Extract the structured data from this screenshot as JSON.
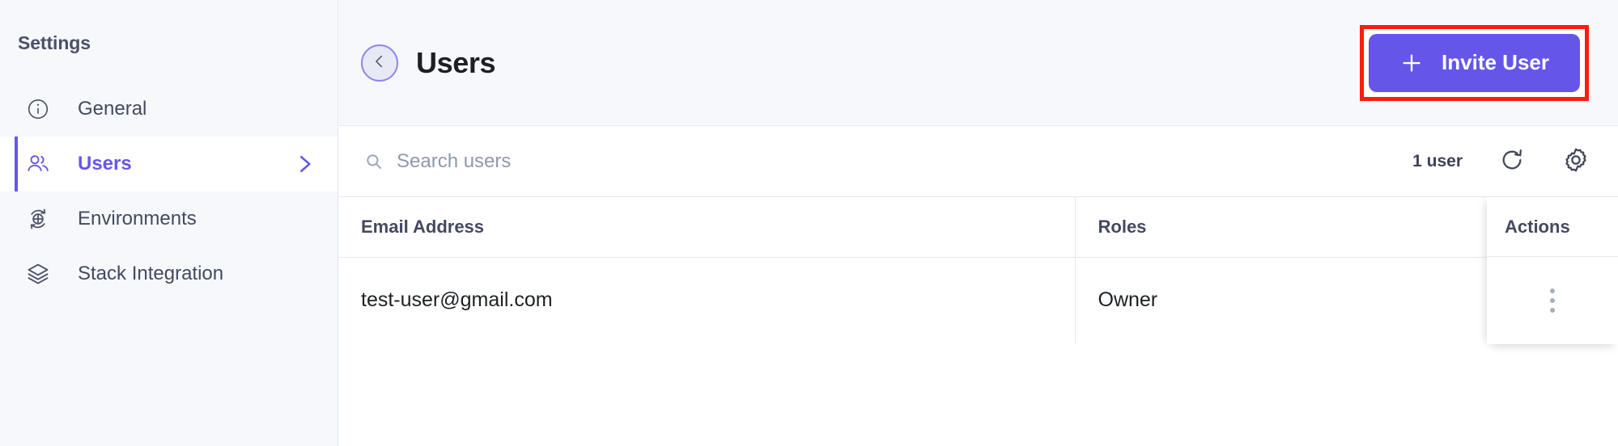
{
  "theme": {
    "accent": "#6556e9",
    "highlight": "#fa1e08",
    "sidebar_bg": "#f6f8fc",
    "header_bg": "#f7f8fc",
    "border": "#e3e8f0",
    "text": "#1c2025",
    "muted": "#8e98b0"
  },
  "sidebar": {
    "title": "Settings",
    "items": [
      {
        "label": "General",
        "icon": "info-circle-icon",
        "active": false
      },
      {
        "label": "Users",
        "icon": "users-icon",
        "active": true
      },
      {
        "label": "Environments",
        "icon": "environments-globe-icon",
        "active": false
      },
      {
        "label": "Stack Integration",
        "icon": "layers-icon",
        "active": false
      }
    ]
  },
  "header": {
    "back_icon": "chevron-left-icon",
    "title": "Users",
    "invite_button": {
      "label": "Invite User",
      "icon": "plus-icon",
      "highlighted": true
    }
  },
  "toolbar": {
    "search": {
      "icon": "search-icon",
      "value": "",
      "placeholder": "Search users"
    },
    "count_label": "1 user",
    "refresh_icon": "refresh-icon",
    "settings_icon": "gear-icon"
  },
  "table": {
    "columns": [
      {
        "key": "email",
        "label": "Email Address"
      },
      {
        "key": "roles",
        "label": "Roles"
      },
      {
        "key": "actions",
        "label": "Actions"
      }
    ],
    "rows": [
      {
        "email": "test-user@gmail.com",
        "roles": "Owner",
        "actions_icon": "kebab-menu-icon"
      }
    ]
  }
}
